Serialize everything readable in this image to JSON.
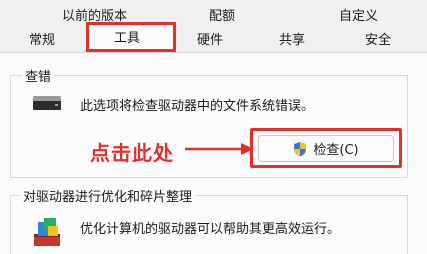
{
  "tabs_row1": [
    {
      "id": "previous-versions",
      "label": "以前的版本"
    },
    {
      "id": "quota",
      "label": "配额"
    },
    {
      "id": "customize",
      "label": "自定义"
    }
  ],
  "tabs_row2": [
    {
      "id": "general",
      "label": "常规"
    },
    {
      "id": "tools",
      "label": "工具",
      "selected": true
    },
    {
      "id": "hardware",
      "label": "硬件"
    },
    {
      "id": "sharing",
      "label": "共享"
    },
    {
      "id": "security",
      "label": "安全"
    }
  ],
  "error_checking": {
    "title": "查错",
    "description": "此选项将检查驱动器中的文件系统错误。",
    "button_label": "检查(C)"
  },
  "optimize": {
    "title": "对驱动器进行优化和碎片整理",
    "description": "优化计算机的驱动器可以帮助其更高效运行。"
  },
  "annotation": {
    "text": "点击此处",
    "color": "#e0312d"
  },
  "icons": {
    "drive": "hard-drive-icon",
    "shield": "uac-shield-icon",
    "defrag": "defragment-icon"
  }
}
